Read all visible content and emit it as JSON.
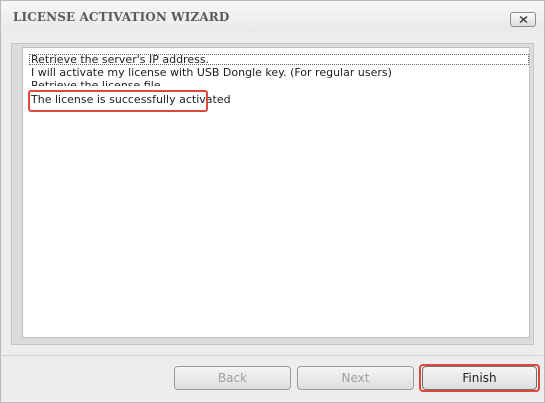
{
  "window": {
    "title": "LICENSE ACTIVATION WIZARD",
    "close_icon": "close-x-icon"
  },
  "log": {
    "lines": [
      "Retrieve the server's IP address.",
      "I will activate my license with USB Dongle key. (For regular users)",
      "Retrieve the license file.",
      "The license is successfully activated"
    ]
  },
  "buttons": {
    "back_label": "Back",
    "next_label": "Next",
    "finish_label": "Finish"
  },
  "colors": {
    "highlight": "#e0463a",
    "disabled_text": "#a0a0a0"
  }
}
